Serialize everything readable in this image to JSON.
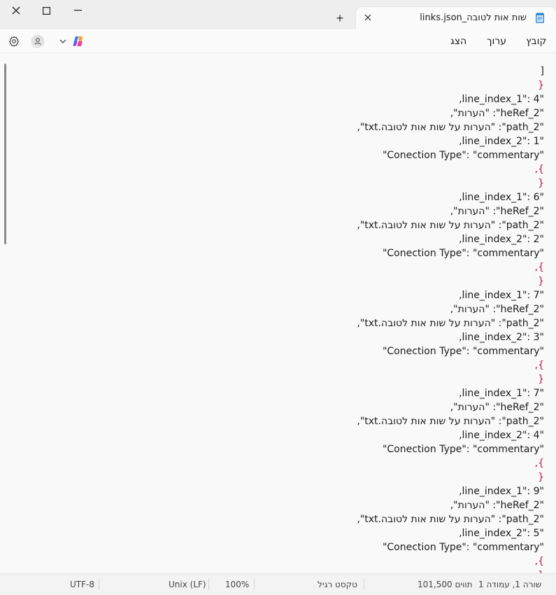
{
  "window": {
    "tab_title": "links.json_שות אות לטובה",
    "new_tab_symbol": "+"
  },
  "menu": {
    "file": "קובץ",
    "edit": "ערוך",
    "view": "הצג"
  },
  "icons": {
    "app": "notepad-icon",
    "close": "close-icon",
    "maximize": "maximize-icon",
    "minimize": "minimize-icon",
    "settings": "gear-icon",
    "profile": "account-icon",
    "copilot": "copilot-icon"
  },
  "editor": {
    "lines": [
      "[",
      "{",
      "\"line_index_1\": 4,",
      "\"heRef_2\": \"הערות\",",
      "\"path_2\": \"הערות על שות אות לטובה.txt\",",
      "\"line_index_2\": 1,",
      "\"Conection Type\": \"commentary\"",
      "},",
      "{",
      "\"line_index_1\": 6,",
      "\"heRef_2\": \"הערות\",",
      "\"path_2\": \"הערות על שות אות לטובה.txt\",",
      "\"line_index_2\": 2,",
      "\"Conection Type\": \"commentary\"",
      "},",
      "{",
      "\"line_index_1\": 7,",
      "\"heRef_2\": \"הערות\",",
      "\"path_2\": \"הערות על שות אות לטובה.txt\",",
      "\"line_index_2\": 3,",
      "\"Conection Type\": \"commentary\"",
      "},",
      "{",
      "\"line_index_1\": 7,",
      "\"heRef_2\": \"הערות\",",
      "\"path_2\": \"הערות על שות אות לטובה.txt\",",
      "\"line_index_2\": 4,",
      "\"Conection Type\": \"commentary\"",
      "},",
      "{",
      "\"line_index_1\": 9,",
      "\"heRef_2\": \"הערות\",",
      "\"path_2\": \"הערות על שות אות לטובה.txt\",",
      "\"line_index_2\": 5,",
      "\"Conection Type\": \"commentary\"",
      "},",
      "{"
    ]
  },
  "status": {
    "position": "שורה 1, עמודה 1",
    "chars": "101,500 תווים",
    "text_mode": "טקסט רגיל",
    "zoom": "100%",
    "line_endings": "Unix (LF)",
    "encoding": "UTF-8"
  },
  "colors": {
    "brace": "#b6174c",
    "background": "#f9f9f9"
  }
}
